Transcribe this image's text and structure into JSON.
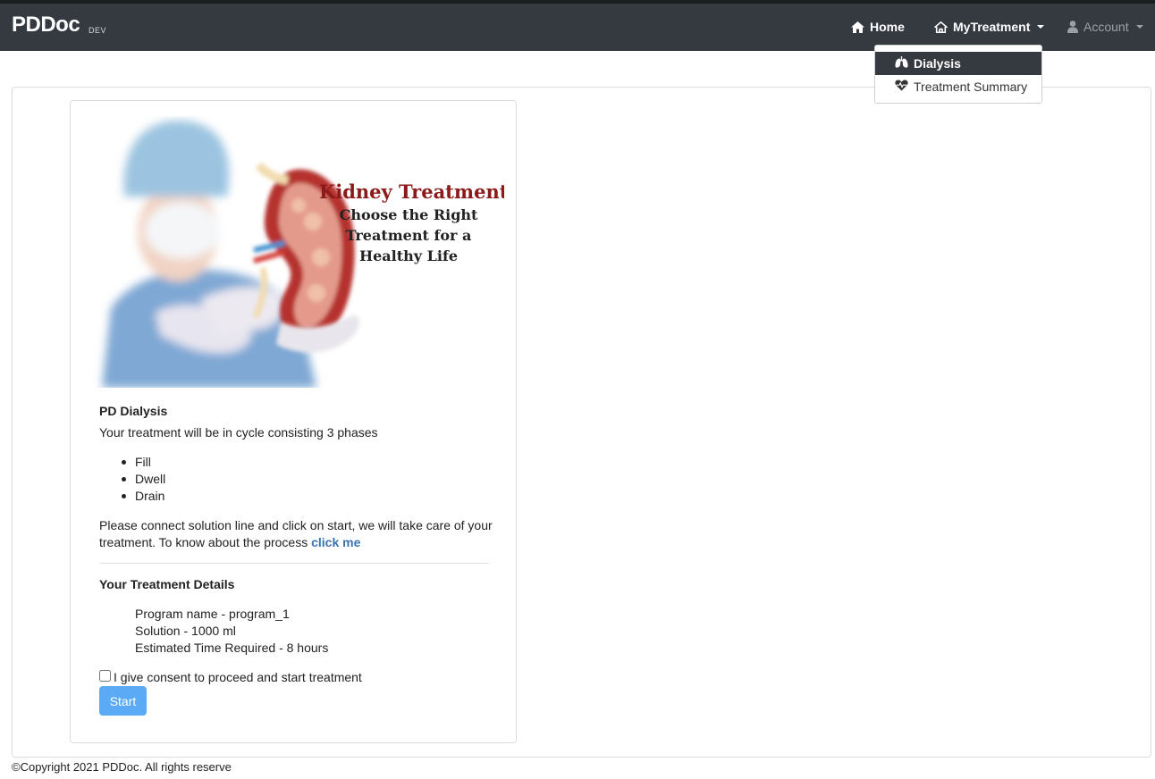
{
  "navbar": {
    "brand": "PDDoc",
    "brand_tag": "DEV",
    "home_label": "Home",
    "mytreatment_label": "MyTreatment",
    "account_label": "Account"
  },
  "dropdown": {
    "items": [
      {
        "label": "Dialysis",
        "icon": "lungs-icon"
      },
      {
        "label": "Treatment Summary",
        "icon": "heartbeat-icon"
      }
    ]
  },
  "hero": {
    "title": "Kidney Treatment",
    "lines": [
      "Choose the Right",
      "Treatment for a",
      "Healthy Life"
    ]
  },
  "content": {
    "heading": "PD Dialysis",
    "intro": "Your treatment will be in cycle consisting 3 phases",
    "phases": [
      "Fill",
      "Dwell",
      "Drain"
    ],
    "instructions_line1": "Please connect solution line and click on start, we will take care of your",
    "instructions_line2": "treatment. To know about the process ",
    "link_label": "click me",
    "details_heading": "Your Treatment Details",
    "details": [
      "Program name - program_1",
      "Solution - 1000 ml",
      "Estimated Time Required - 8 hours"
    ],
    "consent_label": "I give consent to proceed and start treatment",
    "start_label": "Start"
  },
  "footer": {
    "text": "©Copyright 2021 PDDoc. All rights reserve"
  },
  "colors": {
    "navbar_bg": "#343a40",
    "accent_link": "#3a72b0",
    "start_button": "#5aaaf5",
    "hero_title": "#8b1a1a"
  }
}
